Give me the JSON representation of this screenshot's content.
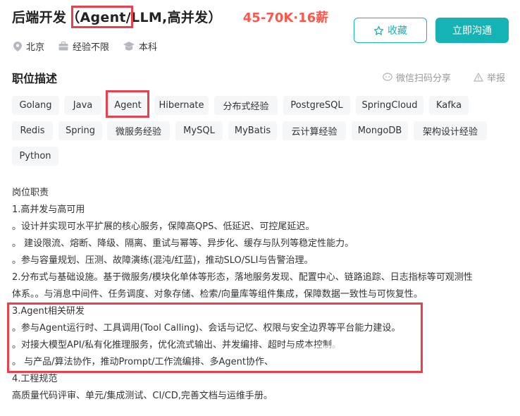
{
  "job": {
    "title": "后端开发（Agent/LLM,高并发）",
    "salary": "45-70K·16薪"
  },
  "actions": {
    "favorite_label": "收藏",
    "chat_label": "立即沟通"
  },
  "meta": {
    "location": "北京",
    "experience": "经验不限",
    "education": "本科"
  },
  "section": {
    "title": "职位描述",
    "share_label": "微信扫码分享",
    "report_label": "举报"
  },
  "tags": [
    "Golang",
    "Java",
    "Agent",
    "Hibernate",
    "分布式经验",
    "PostgreSQL",
    "SpringCloud",
    "Kafka",
    "Redis",
    "Spring",
    "微服务经验",
    "MySQL",
    "MyBatis",
    "云计算经验",
    "MongoDB",
    "架构设计经验",
    "Python"
  ],
  "description": [
    "岗位职责",
    "1.高并发与高可用",
    "。设计并实现可水平扩展的核心服务，保障高QPS、低延迟、可控尾延迟。",
    "。 建设限流、熔断、降级、隔离、重试与幂等、异步化、缓存与队列等稳定性能力。",
    "。参与容量规划、压测、故障演练(混沌/红蓝)，推动SLO/SLI与告警治理。",
    "2.分布式与基础设施。基于微服务/模块化单体等形态，落地服务发现、配置中心、链路追踪、日志指标等可观测性",
    "体系。。与消息中间件、任务调度、对象存储、检索/向量库等组件集成，保障数据一致性与可恢复性。",
    "3.Agent相关研发",
    "。参与Agent运行时、工具调用(Tool Calling)、会话与记忆、权限与安全边界等平台能力建设。",
    "。对接大模型API/私有化推理服务，优化流式输出、并发编排、超时与成本控制。",
    "。 与产品/算法协作，推动Prompt/工作流编排、多Agent协作、",
    "4.工程规范",
    "高质量代码评审、单元/集成测试、CI/CD,完善文档与运维手册。"
  ]
}
